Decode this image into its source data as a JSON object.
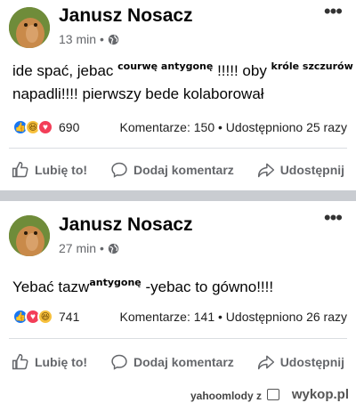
{
  "posts": [
    {
      "author": "Janusz Nosacz",
      "time": "13 min",
      "sep": "•",
      "more_glyph": "•••",
      "text_line1_a": "ide spać,  jebac ",
      "overlay1": "courwę antygonę",
      "text_line1_b": " !!!!! oby ",
      "overlay2": "króle szczurów",
      "text_line2": "napadli!!!! pierwszy bede kolaborował",
      "reactions": [
        "like",
        "haha",
        "love"
      ],
      "reaction_count": "690",
      "comments": "Komentarze: 150",
      "shares": "Udostępniono 25 razy"
    },
    {
      "author": "Janusz Nosacz",
      "time": "27 min",
      "sep": "•",
      "more_glyph": "•••",
      "text_a": "Yebać tazw",
      "overlay1": "antygonę",
      "text_b": " -yebac to gówno!!!!",
      "reactions": [
        "like",
        "love",
        "haha"
      ],
      "reaction_count": "741",
      "comments": "Komentarze: 141",
      "shares": "Udostępniono 26 razy"
    }
  ],
  "actions": {
    "like": "Lubię to!",
    "comment": "Dodaj komentarz",
    "share": "Udostępnij"
  },
  "stats_sep": "•",
  "footer": {
    "user": "yahoomlody",
    "z": "z",
    "site": "wykop.pl"
  }
}
